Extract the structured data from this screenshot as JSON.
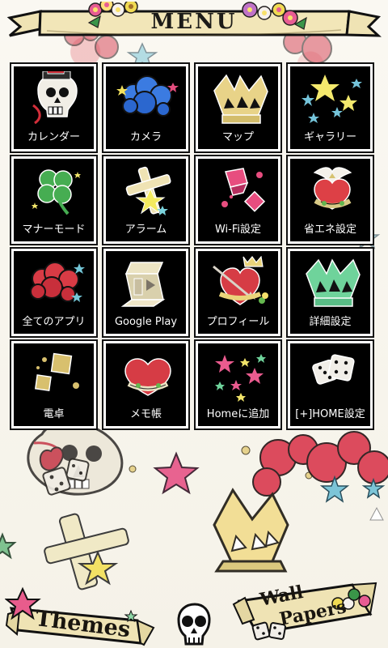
{
  "header": {
    "title": "MENU"
  },
  "tiles": [
    {
      "label": "カレンダー",
      "icon": "skull-top-hat-icon"
    },
    {
      "label": "カメラ",
      "icon": "blue-roses-icon"
    },
    {
      "label": "マップ",
      "icon": "gold-crown-icon"
    },
    {
      "label": "ギャラリー",
      "icon": "stars-icon"
    },
    {
      "label": "マナーモード",
      "icon": "clover-icon"
    },
    {
      "label": "アラーム",
      "icon": "cross-star-icon"
    },
    {
      "label": "Wi-Fi設定",
      "icon": "pink-gems-icon"
    },
    {
      "label": "省エネ設定",
      "icon": "bird-heart-icon"
    },
    {
      "label": "全てのアプリ",
      "icon": "red-roses-icon"
    },
    {
      "label": "Google Play",
      "icon": "play-ribbon-icon"
    },
    {
      "label": "プロフィール",
      "icon": "heart-crown-icon"
    },
    {
      "label": "詳細設定",
      "icon": "green-crown-icon"
    },
    {
      "label": "電卓",
      "icon": "gold-gems-icon"
    },
    {
      "label": "メモ帳",
      "icon": "dream-heart-icon"
    },
    {
      "label": "Homeに追加",
      "icon": "neon-stars-icon"
    },
    {
      "label": "[+]HOME設定",
      "icon": "dice-icon"
    }
  ],
  "bottom": {
    "themes_label": "Themes",
    "wall_label": "Wall",
    "papers_label": "Papers"
  },
  "colors": {
    "tile_bg": "#000000",
    "tile_border": "#ffffff",
    "banner_fill": "#f2e6b8",
    "banner_outline": "#111111"
  }
}
